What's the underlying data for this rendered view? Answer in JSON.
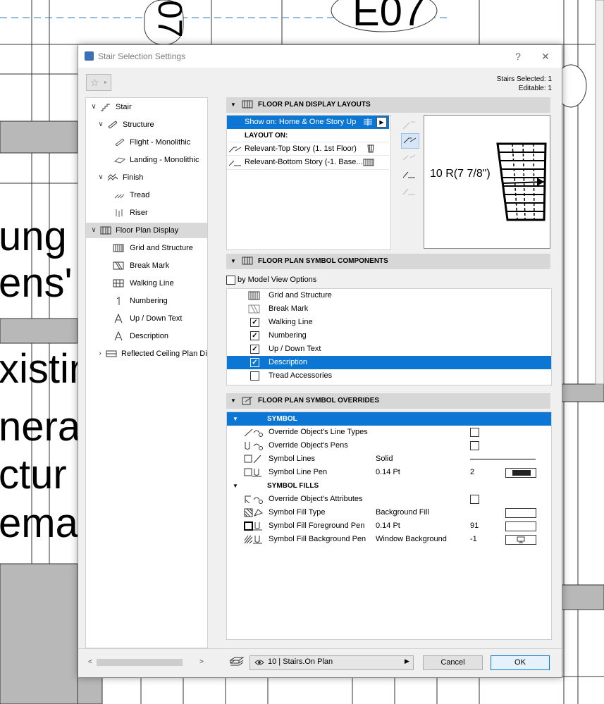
{
  "background": {
    "label_e07": "E07",
    "label_07": "07",
    "text_lines": [
      "ung",
      "ens'",
      "xistir",
      "nera",
      "ctur",
      "emai"
    ]
  },
  "dialog": {
    "title": "Stair Selection Settings",
    "help": "?",
    "close": "✕",
    "stairs_selected": "Stairs Selected: 1",
    "editable": "Editable: 1"
  },
  "tree": {
    "items": [
      {
        "label": "Stair",
        "icon": "stair-icon"
      },
      {
        "label": "Structure",
        "icon": "structure-icon"
      },
      {
        "label": "Flight - Monolithic",
        "icon": "flight-icon"
      },
      {
        "label": "Landing - Monolithic",
        "icon": "landing-icon"
      },
      {
        "label": "Finish",
        "icon": "finish-icon"
      },
      {
        "label": "Tread",
        "icon": "tread-icon"
      },
      {
        "label": "Riser",
        "icon": "riser-icon"
      },
      {
        "label": "Floor Plan Display",
        "icon": "floor-plan-display-icon"
      },
      {
        "label": "Grid and Structure",
        "icon": "grid-structure-icon"
      },
      {
        "label": "Break Mark",
        "icon": "break-mark-icon"
      },
      {
        "label": "Walking Line",
        "icon": "walking-line-icon"
      },
      {
        "label": "Numbering",
        "icon": "numbering-icon"
      },
      {
        "label": "Up / Down Text",
        "icon": "up-down-text-icon"
      },
      {
        "label": "Description",
        "icon": "description-icon"
      },
      {
        "label": "Reflected Ceiling Plan Di",
        "icon": "ceiling-plan-icon"
      }
    ]
  },
  "layouts": {
    "header": "FLOOR PLAN DISPLAY LAYOUTS",
    "show_on": "Show on: Home & One Story Up",
    "layout_on": "LAYOUT ON:",
    "rows": [
      {
        "label": "Relevant-Top Story (1. 1st Floor)"
      },
      {
        "label": "Relevant-Bottom Story (-1. Base..."
      }
    ],
    "preview_text": "10 R(7 7/8\")"
  },
  "components": {
    "header": "FLOOR PLAN SYMBOL COMPONENTS",
    "by_model_view": "by Model View Options",
    "rows": [
      {
        "label": "Grid and Structure",
        "checked": ""
      },
      {
        "label": "Break Mark",
        "checked": ""
      },
      {
        "label": "Walking Line",
        "checked": "✓"
      },
      {
        "label": "Numbering",
        "checked": "✓"
      },
      {
        "label": "Up / Down Text",
        "checked": "✓"
      },
      {
        "label": "Description",
        "checked": "✓"
      },
      {
        "label": "Tread Accessories",
        "checked": ""
      }
    ]
  },
  "overrides": {
    "header": "FLOOR PLAN SYMBOL OVERRIDES",
    "symbol_group": "SYMBOL",
    "fills_group": "SYMBOL FILLS",
    "rows": [
      {
        "label": "Override Object's Line Types",
        "value": "",
        "num": ""
      },
      {
        "label": "Override Object's Pens",
        "value": "",
        "num": ""
      },
      {
        "label": "Symbol Lines",
        "value": "Solid",
        "num": ""
      },
      {
        "label": "Symbol Line Pen",
        "value": "0.14 Pt",
        "num": "2"
      },
      {
        "label": "Override Object's Attributes",
        "value": "",
        "num": ""
      },
      {
        "label": "Symbol Fill Type",
        "value": "Background Fill",
        "num": ""
      },
      {
        "label": "Symbol Fill Foreground Pen",
        "value": "0.14 Pt",
        "num": "91"
      },
      {
        "label": "Symbol Fill Background Pen",
        "value": "Window Background",
        "num": "-1"
      }
    ]
  },
  "footer": {
    "layer": "10 | Stairs.On Plan",
    "cancel": "Cancel",
    "ok": "OK"
  },
  "colors": {
    "selection": "#0b76d4",
    "section_header": "#d7d7d7"
  }
}
